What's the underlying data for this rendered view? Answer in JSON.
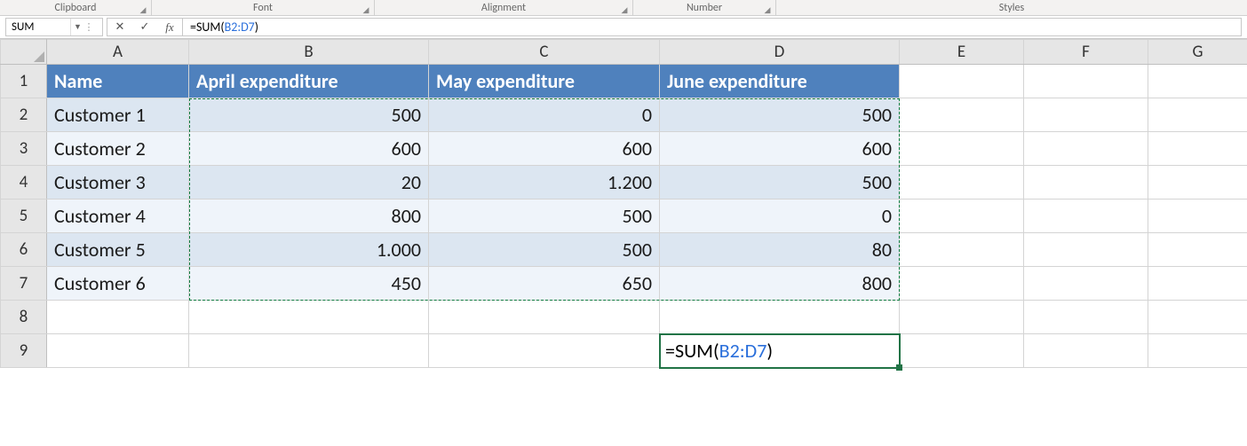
{
  "ribbon": {
    "groups": [
      "Clipboard",
      "Font",
      "Alignment",
      "Number",
      "Styles"
    ]
  },
  "formulaBar": {
    "nameBox": "SUM",
    "formulaPrefix": "=SUM(",
    "formulaRef": "B2:D7",
    "formulaSuffix": ")"
  },
  "columns": [
    "A",
    "B",
    "C",
    "D",
    "E",
    "F",
    "G"
  ],
  "rows": [
    "1",
    "2",
    "3",
    "4",
    "5",
    "6",
    "7",
    "8",
    "9"
  ],
  "headerRow": {
    "A": "Name",
    "B": "April expenditure",
    "C": "May expenditure",
    "D": "June expenditure"
  },
  "data": [
    {
      "name": "Customer 1",
      "b": "500",
      "c": "0",
      "d": "500"
    },
    {
      "name": "Customer 2",
      "b": "600",
      "c": "600",
      "d": "600"
    },
    {
      "name": "Customer 3",
      "b": "20",
      "c": "1.200",
      "d": "500"
    },
    {
      "name": "Customer 4",
      "b": "800",
      "c": "500",
      "d": "0"
    },
    {
      "name": "Customer 5",
      "b": "1.000",
      "c": "500",
      "d": "80"
    },
    {
      "name": "Customer 6",
      "b": "450",
      "c": "650",
      "d": "800"
    }
  ],
  "editCell": {
    "prefix": "=SUM(",
    "ref": "B2:D7",
    "suffix": ")"
  },
  "colWidths": {
    "row": 52,
    "A": 160,
    "B": 270,
    "C": 260,
    "D": 270,
    "E": 140,
    "F": 140,
    "G": 112
  },
  "activeRow": "9",
  "activeCol": "D"
}
